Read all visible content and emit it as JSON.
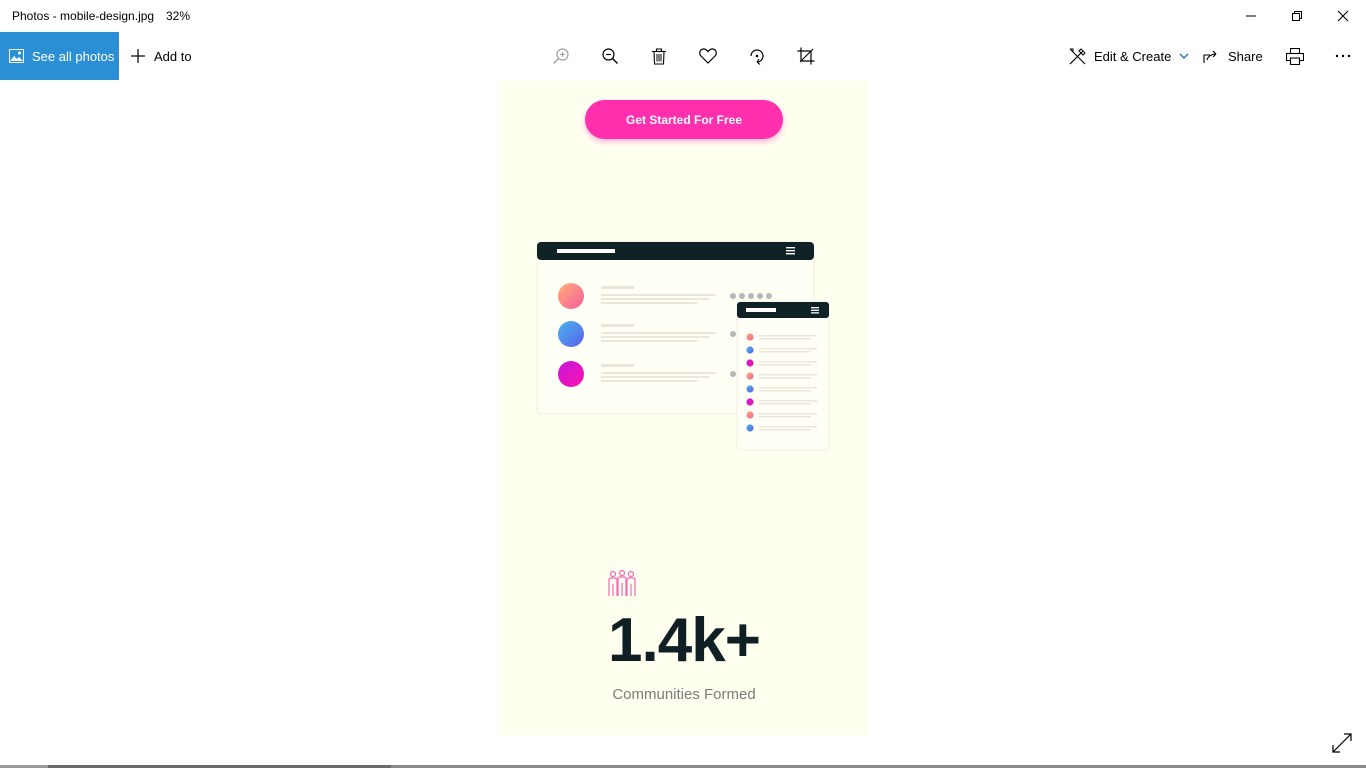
{
  "window": {
    "title": "Photos - mobile-design.jpg",
    "zoom": "32%"
  },
  "toolbar": {
    "see_all_label": "See all photos",
    "add_to_label": "Add to",
    "edit_create_label": "Edit & Create",
    "share_label": "Share",
    "icons": [
      "zoom-in-icon",
      "zoom-out-icon",
      "delete-icon",
      "heart-icon",
      "rotate-icon",
      "crop-icon",
      "print-icon",
      "more-icon"
    ]
  },
  "photo": {
    "cta_label": "Get Started For Free",
    "stat_value": "1.4k+",
    "stat_caption": "Communities Formed"
  },
  "colors": {
    "accent": "#2b8fd6",
    "cta": "#ff2fad",
    "photo_bg": "#fffff0",
    "dark": "#0f1f24"
  }
}
